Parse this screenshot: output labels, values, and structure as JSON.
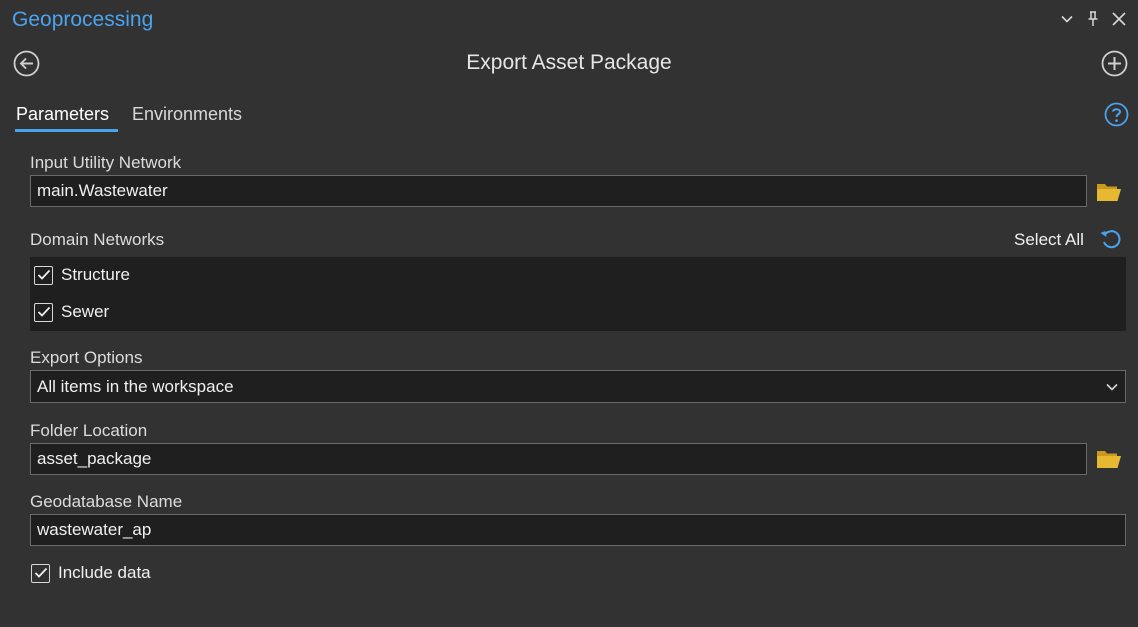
{
  "pane": {
    "title": "Geoprocessing",
    "accent_color": "#4ba3ee",
    "window_buttons": [
      "chevron-down-icon",
      "pin-icon",
      "close-icon"
    ]
  },
  "tool": {
    "title": "Export Asset Package",
    "back_icon": "back-arrow-circle-icon",
    "add_icon": "plus-circle-icon"
  },
  "tabs": [
    {
      "label": "Parameters",
      "active": true
    },
    {
      "label": "Environments",
      "active": false
    }
  ],
  "help_icon": "help-icon",
  "params": {
    "input_utility_network": {
      "label": "Input Utility Network",
      "value": "main.Wastewater",
      "folder_color": "#e0b230"
    },
    "domain_networks": {
      "label": "Domain Networks",
      "select_all_label": "Select All",
      "items": [
        {
          "label": "Structure",
          "checked": true
        },
        {
          "label": "Sewer",
          "checked": true
        }
      ]
    },
    "export_options": {
      "label": "Export Options",
      "value": "All items in the workspace"
    },
    "folder_location": {
      "label": "Folder Location",
      "value": "asset_package"
    },
    "geodatabase_name": {
      "label": "Geodatabase Name",
      "value": "wastewater_ap"
    },
    "include_data": {
      "label": "Include data",
      "checked": true
    }
  }
}
